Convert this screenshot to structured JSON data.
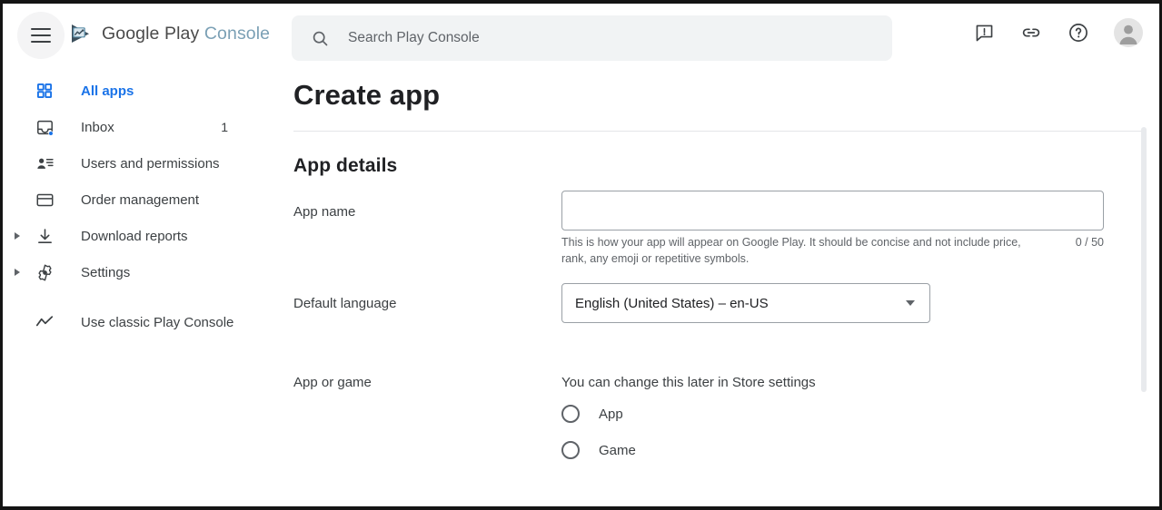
{
  "window": {
    "frame_color": "#141414"
  },
  "topbar": {
    "menu_icon": "hamburger-icon",
    "brand": {
      "logo_icon": "google-play-console-logo",
      "text_primary": "Google Play",
      "text_secondary": "Console",
      "color_primary": "#4a4a4a",
      "color_secondary": "#7ba0b5"
    },
    "search": {
      "icon": "search-icon",
      "placeholder": "Search Play Console",
      "value": ""
    },
    "actions": [
      {
        "name": "feedback-icon",
        "label": "Send feedback"
      },
      {
        "name": "link-icon",
        "label": "Link"
      },
      {
        "name": "help-icon",
        "label": "Help"
      }
    ],
    "avatar": {
      "icon": "account-avatar-icon"
    }
  },
  "sidebar": {
    "items": [
      {
        "label": "All apps",
        "icon": "grid-apps-icon",
        "active": true,
        "badge": "",
        "expander": false
      },
      {
        "label": "Inbox",
        "icon": "inbox-icon",
        "active": false,
        "badge": "1",
        "expander": false
      },
      {
        "label": "Users and permissions",
        "icon": "users-permissions-icon",
        "active": false,
        "badge": "",
        "expander": false
      },
      {
        "label": "Order management",
        "icon": "order-management-icon",
        "active": false,
        "badge": "",
        "expander": false
      },
      {
        "label": "Download reports",
        "icon": "download-icon",
        "active": false,
        "badge": "",
        "expander": true
      },
      {
        "label": "Settings",
        "icon": "gear-icon",
        "active": false,
        "badge": "",
        "expander": true
      }
    ],
    "footer_item": {
      "label": "Use classic Play Console",
      "icon": "trending-line-icon"
    },
    "active_color": "#1a73e8"
  },
  "main": {
    "page_title": "Create app",
    "section_title": "App details",
    "fields": {
      "app_name": {
        "label": "App name",
        "value": "",
        "placeholder": "",
        "helper": "This is how your app will appear on Google Play. It should be concise and not include price, rank, any emoji or repetitive symbols.",
        "counter": "0 / 50"
      },
      "default_language": {
        "label": "Default language",
        "selected": "English (United States) – en-US",
        "arrow_icon": "chevron-down-icon"
      },
      "app_or_game": {
        "label": "App or game",
        "hint": "You can change this later in Store settings",
        "options": [
          {
            "label": "App",
            "selected": false
          },
          {
            "label": "Game",
            "selected": false
          }
        ]
      }
    }
  }
}
